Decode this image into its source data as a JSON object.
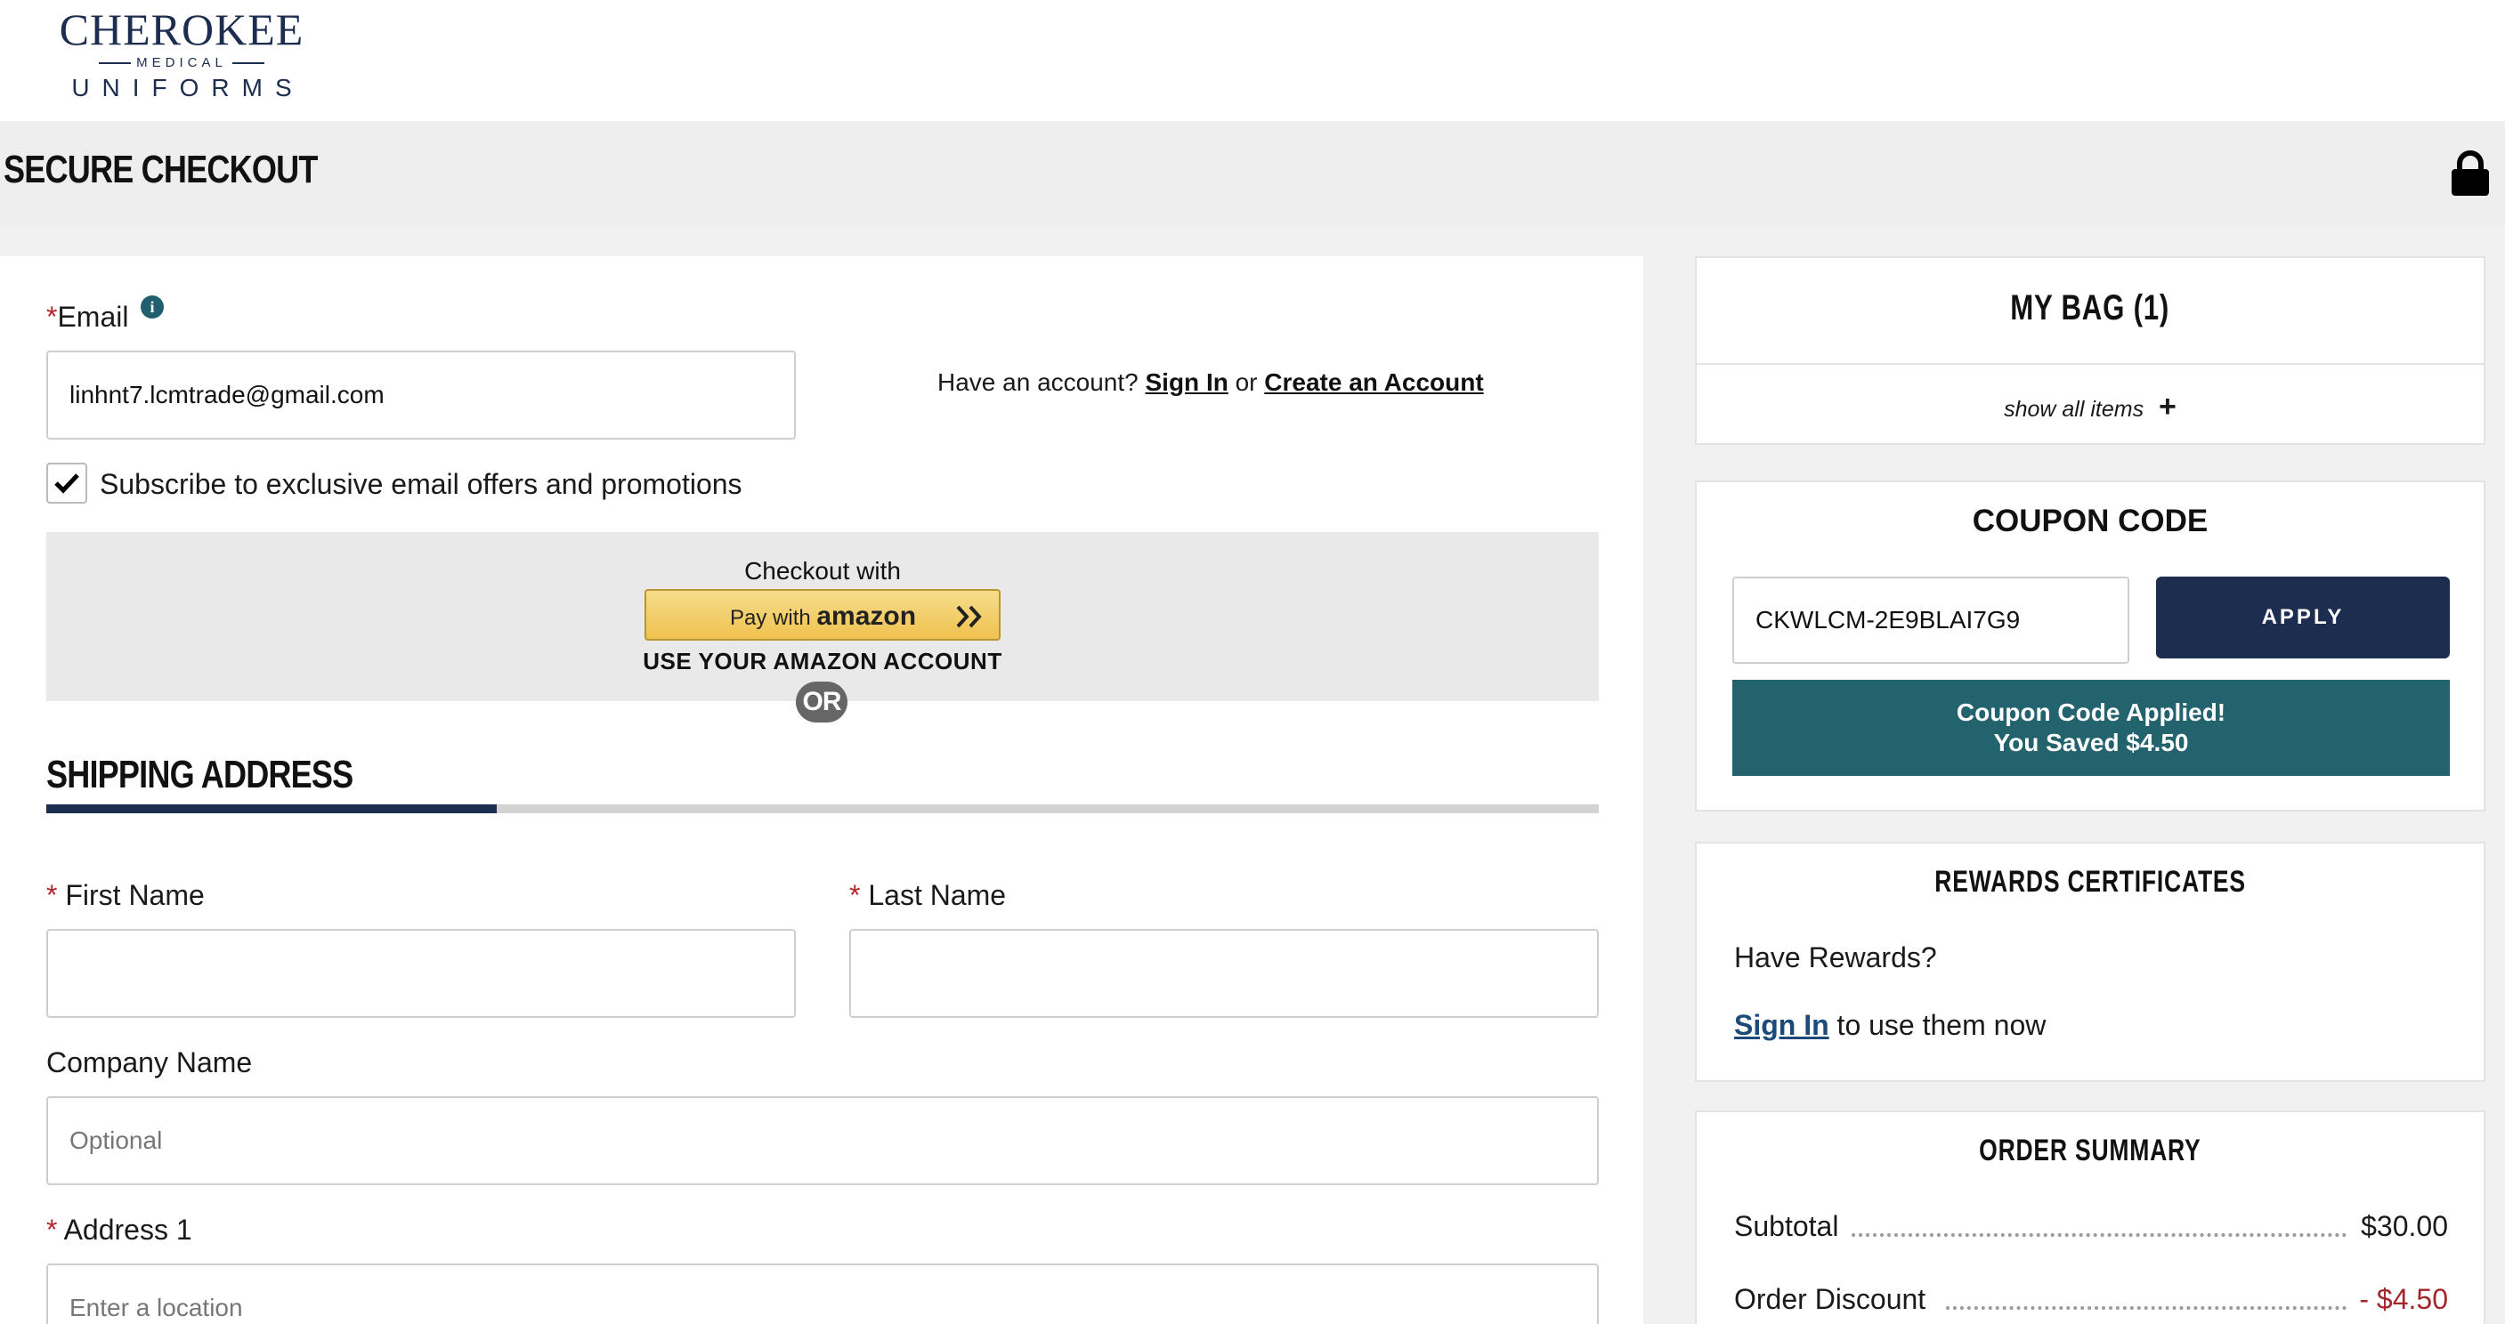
{
  "brand": {
    "main": "CHEROKEE",
    "sub": "MEDICAL",
    "bottom": "UNIFORMS"
  },
  "header": {
    "title": "SECURE CHECKOUT",
    "lock_icon": "lock-icon"
  },
  "contact": {
    "email_label": "Email",
    "email_required": "*",
    "email_value": "linhnt7.lcmtrade@gmail.com",
    "account_prompt": "Have an account?",
    "sign_in": "Sign In",
    "or_text": "or",
    "create_account": "Create an Account",
    "subscribe_label": "Subscribe to exclusive email offers and promotions",
    "subscribe_checked": true
  },
  "amazon": {
    "checkout_with": "Checkout with",
    "pay_with": "Pay with",
    "brand": "amazon",
    "use_account": "USE YOUR AMAZON ACCOUNT",
    "or_badge": "OR"
  },
  "shipping": {
    "title": "SHIPPING ADDRESS",
    "step_progress_percent": 29,
    "first_name_label": "First Name",
    "last_name_label": "Last Name",
    "company_label": "Company Name",
    "company_placeholder": "Optional",
    "address1_label": "Address 1",
    "address1_placeholder": "Enter a location",
    "required_mark": "*"
  },
  "bag": {
    "title": "MY BAG (1)",
    "show_all": "show all items",
    "plus": "+"
  },
  "coupon": {
    "title": "COUPON CODE",
    "code_value": "CKWLCM-2E9BLAI7G9",
    "apply_label": "APPLY",
    "applied_line1": "Coupon Code Applied!",
    "applied_line2": "You Saved $4.50"
  },
  "rewards": {
    "title": "REWARDS CERTIFICATES",
    "question": "Have Rewards?",
    "sign_in": "Sign In",
    "suffix": "to use them now"
  },
  "summary": {
    "title": "ORDER SUMMARY",
    "subtotal_label": "Subtotal",
    "subtotal_value": "$30.00",
    "discount_label": "Order Discount",
    "discount_value": "- $4.50",
    "discount_color": "#a3262a"
  },
  "colors": {
    "navy": "#1c2d4f",
    "teal": "#23636e",
    "required": "#b3262c"
  }
}
